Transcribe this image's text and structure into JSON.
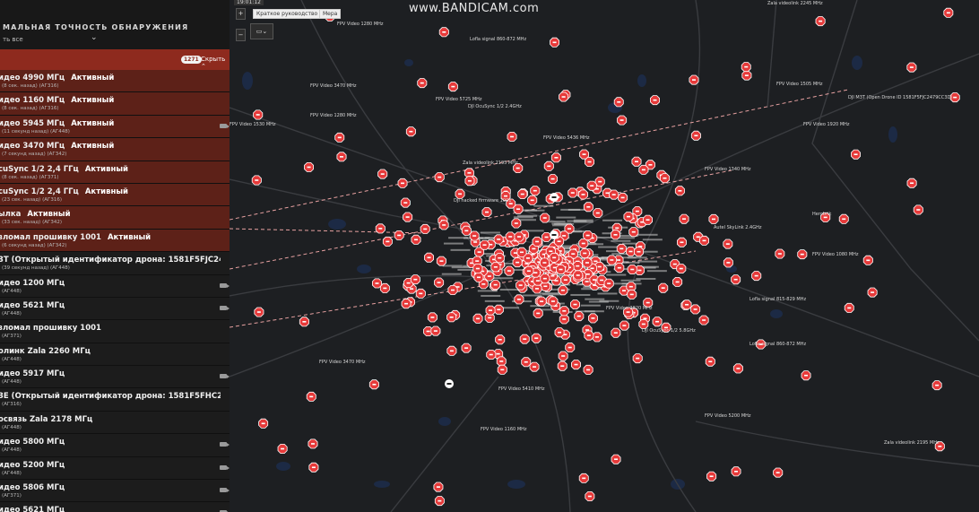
{
  "sidebar": {
    "title": "МАЛЬНАЯ ТОЧНОСТЬ ОБНАРУЖЕНИЯ",
    "filter": "ть все",
    "count_badge": "1271",
    "hide_label": "Скрыть",
    "rows": [
      {
        "title": "идео 4990 МГц",
        "status": "Активный",
        "sub": "(8 сек. назад) (АГ316)",
        "active": true,
        "camera": false
      },
      {
        "title": "идео 1160 МГц",
        "status": "Активный",
        "sub": "(8 сек. назад) (АГ316)",
        "active": true,
        "camera": false
      },
      {
        "title": "идео 5945 МГц",
        "status": "Активный",
        "sub": "(11 секунд назад) (АГ448)",
        "active": true,
        "camera": true
      },
      {
        "title": "идео 3470 МГц",
        "status": "Активный",
        "sub": "(7 секунд назад) (АГ342)",
        "active": true,
        "camera": false
      },
      {
        "title": "cuSync 1/2 2,4 ГГц",
        "status": "Активный",
        "sub": "(8 сек. назад) (АГ371)",
        "active": true,
        "camera": false
      },
      {
        "title": "cuSync 1/2 2,4 ГГц",
        "status": "Активный",
        "sub": "(23 сек. назад) (АГ316)",
        "active": true,
        "camera": false
      },
      {
        "title": "ылка",
        "status": "Активный",
        "sub": "(33 сек. назад) (АГ342)",
        "active": true,
        "camera": false
      },
      {
        "title": "зломал прошивку 1001",
        "status": "Активный",
        "sub": "(6 секунд назад) (АГ342)",
        "active": true,
        "camera": false
      },
      {
        "title": "3Т (Открытый идентификатор дрона: 1581F5FJC2479-",
        "status": "",
        "sub": "(39 секунд назад) (АГ448)",
        "active": false,
        "camera": false
      },
      {
        "title": "идео 1200 МГц",
        "status": "",
        "sub": "(АГ448)",
        "active": false,
        "camera": true
      },
      {
        "title": "идео 5621 МГц",
        "status": "",
        "sub": "(АГ448)",
        "active": false,
        "camera": true
      },
      {
        "title": "зломал прошивку 1001",
        "status": "",
        "sub": "(АГ371)",
        "active": false,
        "camera": false
      },
      {
        "title": "олинк Zala 2260 МГц",
        "status": "",
        "sub": "(АГ448)",
        "active": false,
        "camera": false
      },
      {
        "title": "идео 5917 МГц",
        "status": "",
        "sub": "(АГ448)",
        "active": false,
        "camera": true
      },
      {
        "title": "3Е (Открытый идентификатор дрона: 1581F5FHC247-",
        "status": "",
        "sub": "(АГ316)",
        "active": false,
        "camera": false
      },
      {
        "title": "освязь Zala 2178 МГц",
        "status": "",
        "sub": "(АГ448)",
        "active": false,
        "camera": false
      },
      {
        "title": "идео 5800 МГц",
        "status": "",
        "sub": "(АГ448)",
        "active": false,
        "camera": true
      },
      {
        "title": "идео 5200 МГц",
        "status": "",
        "sub": "(АГ448)",
        "active": false,
        "camera": true
      },
      {
        "title": "идео 5806 МГц",
        "status": "",
        "sub": "(АГ371)",
        "active": false,
        "camera": true
      },
      {
        "title": "идео 5621 МГц",
        "status": "",
        "sub": "(АГ448)",
        "active": false,
        "camera": true
      }
    ]
  },
  "map": {
    "top_time": "19:01:12",
    "buttons": {
      "guide": "Краткое руководство",
      "measure": "Мера"
    },
    "watermark": "www.BANDICAM.com",
    "marker_color": "#e63a3a",
    "labels": [
      "FPV Video 1280 MHz",
      "Lofla signal 860-872 MHz",
      "Zala videolink 2245 MHz",
      "FPV Video 1505 MHz",
      "FPV Video 3470 MHz",
      "DJI OcuSync 1/2 2.4GHz",
      "FPV Video 5725 MHz",
      "FPV Video 1530 MHz",
      "FPV Video 1280 MHz",
      "DJI hacked firmware 1001",
      "Zala videolink 2195 MHz",
      "FPV Video 5436 MHz",
      "Autel SkyLink 2.4GHz",
      "FPV Video 1080 MHz",
      "Lofla signal 860-872 MHz",
      "FPV Video 3470 MHz",
      "DJI OcuSync 1/2 5.8GHz",
      "FPV Video 5200 MHz",
      "Zala videolink 2195 MHz",
      "Herobrik",
      "DJI M3T (Open Drone ID 1581F5FJC2479CC3D)",
      "FPV Video 1340 MHz",
      "FPV Video 5410 MHz",
      "FPV Video 1160 MHz",
      "FPV Video 1920 MHz",
      "Lofla signal 815-829 MHz",
      "FPV Video 3820 MHz"
    ]
  }
}
